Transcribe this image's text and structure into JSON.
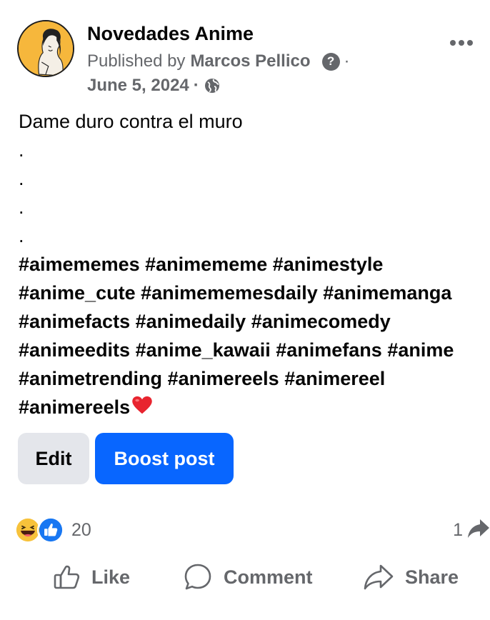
{
  "post": {
    "page_name": "Novedades Anime",
    "published_by_label": "Published by",
    "author": "Marcos Pellico",
    "help_glyph": "?",
    "separator": "·",
    "date": "June 5, 2024",
    "audience_icon": "globe-icon",
    "more_icon": "more-options-icon",
    "body_lines": [
      "Dame duro contra el muro",
      ".",
      ".",
      ".",
      "."
    ],
    "hashtags": [
      "#aimememes",
      "#animememe",
      "#animestyle",
      "#anime_cute",
      "#animememesdaily",
      "#animemanga",
      "#animefacts",
      "#animedaily",
      "#animecomedy",
      "#animeedits",
      "#anime_kawaii",
      "#animefans",
      "#anime",
      "#animetrending",
      "#animereels",
      "#animereel",
      "#animereels"
    ],
    "trailing_emoji": "red-heart-icon"
  },
  "buttons": {
    "edit": "Edit",
    "boost": "Boost post"
  },
  "reactions": {
    "icons": [
      "haha-icon",
      "like-icon"
    ],
    "count": "20"
  },
  "shares": {
    "count": "1",
    "icon": "share-arrow-icon"
  },
  "actions": {
    "like": "Like",
    "comment": "Comment",
    "share": "Share"
  },
  "colors": {
    "brand_blue": "#0866ff",
    "secondary_text": "#65676b",
    "edit_bg": "#e4e6eb"
  }
}
